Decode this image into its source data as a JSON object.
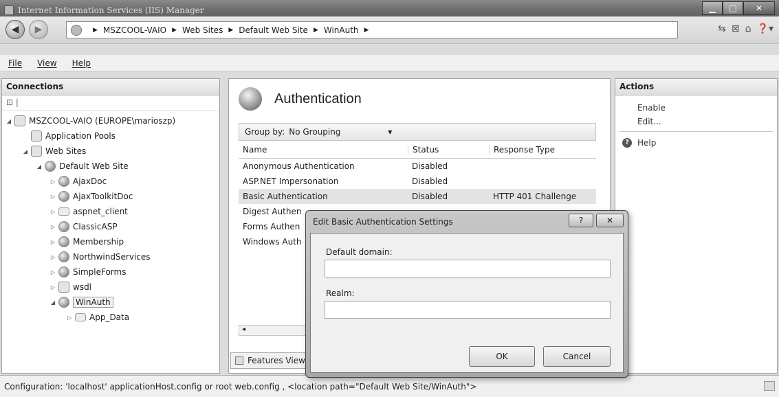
{
  "window": {
    "title": "Internet Information Services (IIS) Manager"
  },
  "address": {
    "crumbs": [
      "MSZCOOL-VAIO",
      "Web Sites",
      "Default Web Site",
      "WinAuth"
    ]
  },
  "menu": {
    "file": "File",
    "view": "View",
    "help": "Help"
  },
  "connections": {
    "title": "Connections",
    "server": "MSZCOOL-VAIO (EUROPE\\marioszp)",
    "app_pools": "Application Pools",
    "web_sites": "Web Sites",
    "default_site": "Default Web Site",
    "children": [
      "AjaxDoc",
      "AjaxToolkitDoc",
      "aspnet_client",
      "ClassicASP",
      "Membership",
      "NorthwindServices",
      "SimpleForms",
      "wsdl",
      "WinAuth"
    ],
    "app_data": "App_Data"
  },
  "feature": {
    "title": "Authentication",
    "groupby_label": "Group by:",
    "groupby_value": "No Grouping",
    "columns": [
      "Name",
      "Status",
      "Response Type"
    ],
    "rows": [
      {
        "name": "Anonymous Authentication",
        "status": "Disabled",
        "response": ""
      },
      {
        "name": "ASP.NET Impersonation",
        "status": "Disabled",
        "response": ""
      },
      {
        "name": "Basic Authentication",
        "status": "Disabled",
        "response": "HTTP 401 Challenge"
      },
      {
        "name": "Digest Authen",
        "status": "",
        "response": ""
      },
      {
        "name": "Forms Authen",
        "status": "",
        "response": ""
      },
      {
        "name": "Windows Auth",
        "status": "",
        "response": ""
      }
    ],
    "features_view": "Features View"
  },
  "actions": {
    "title": "Actions",
    "enable": "Enable",
    "edit": "Edit...",
    "help": "Help"
  },
  "dialog": {
    "title": "Edit Basic Authentication Settings",
    "help_btn": "?",
    "close_btn": "✕",
    "domain_label": "Default domain:",
    "domain_value": "",
    "realm_label": "Realm:",
    "realm_value": "",
    "ok": "OK",
    "cancel": "Cancel"
  },
  "status": {
    "text": "Configuration: 'localhost' applicationHost.config or root web.config , <location path=\"Default Web Site/WinAuth\">"
  }
}
